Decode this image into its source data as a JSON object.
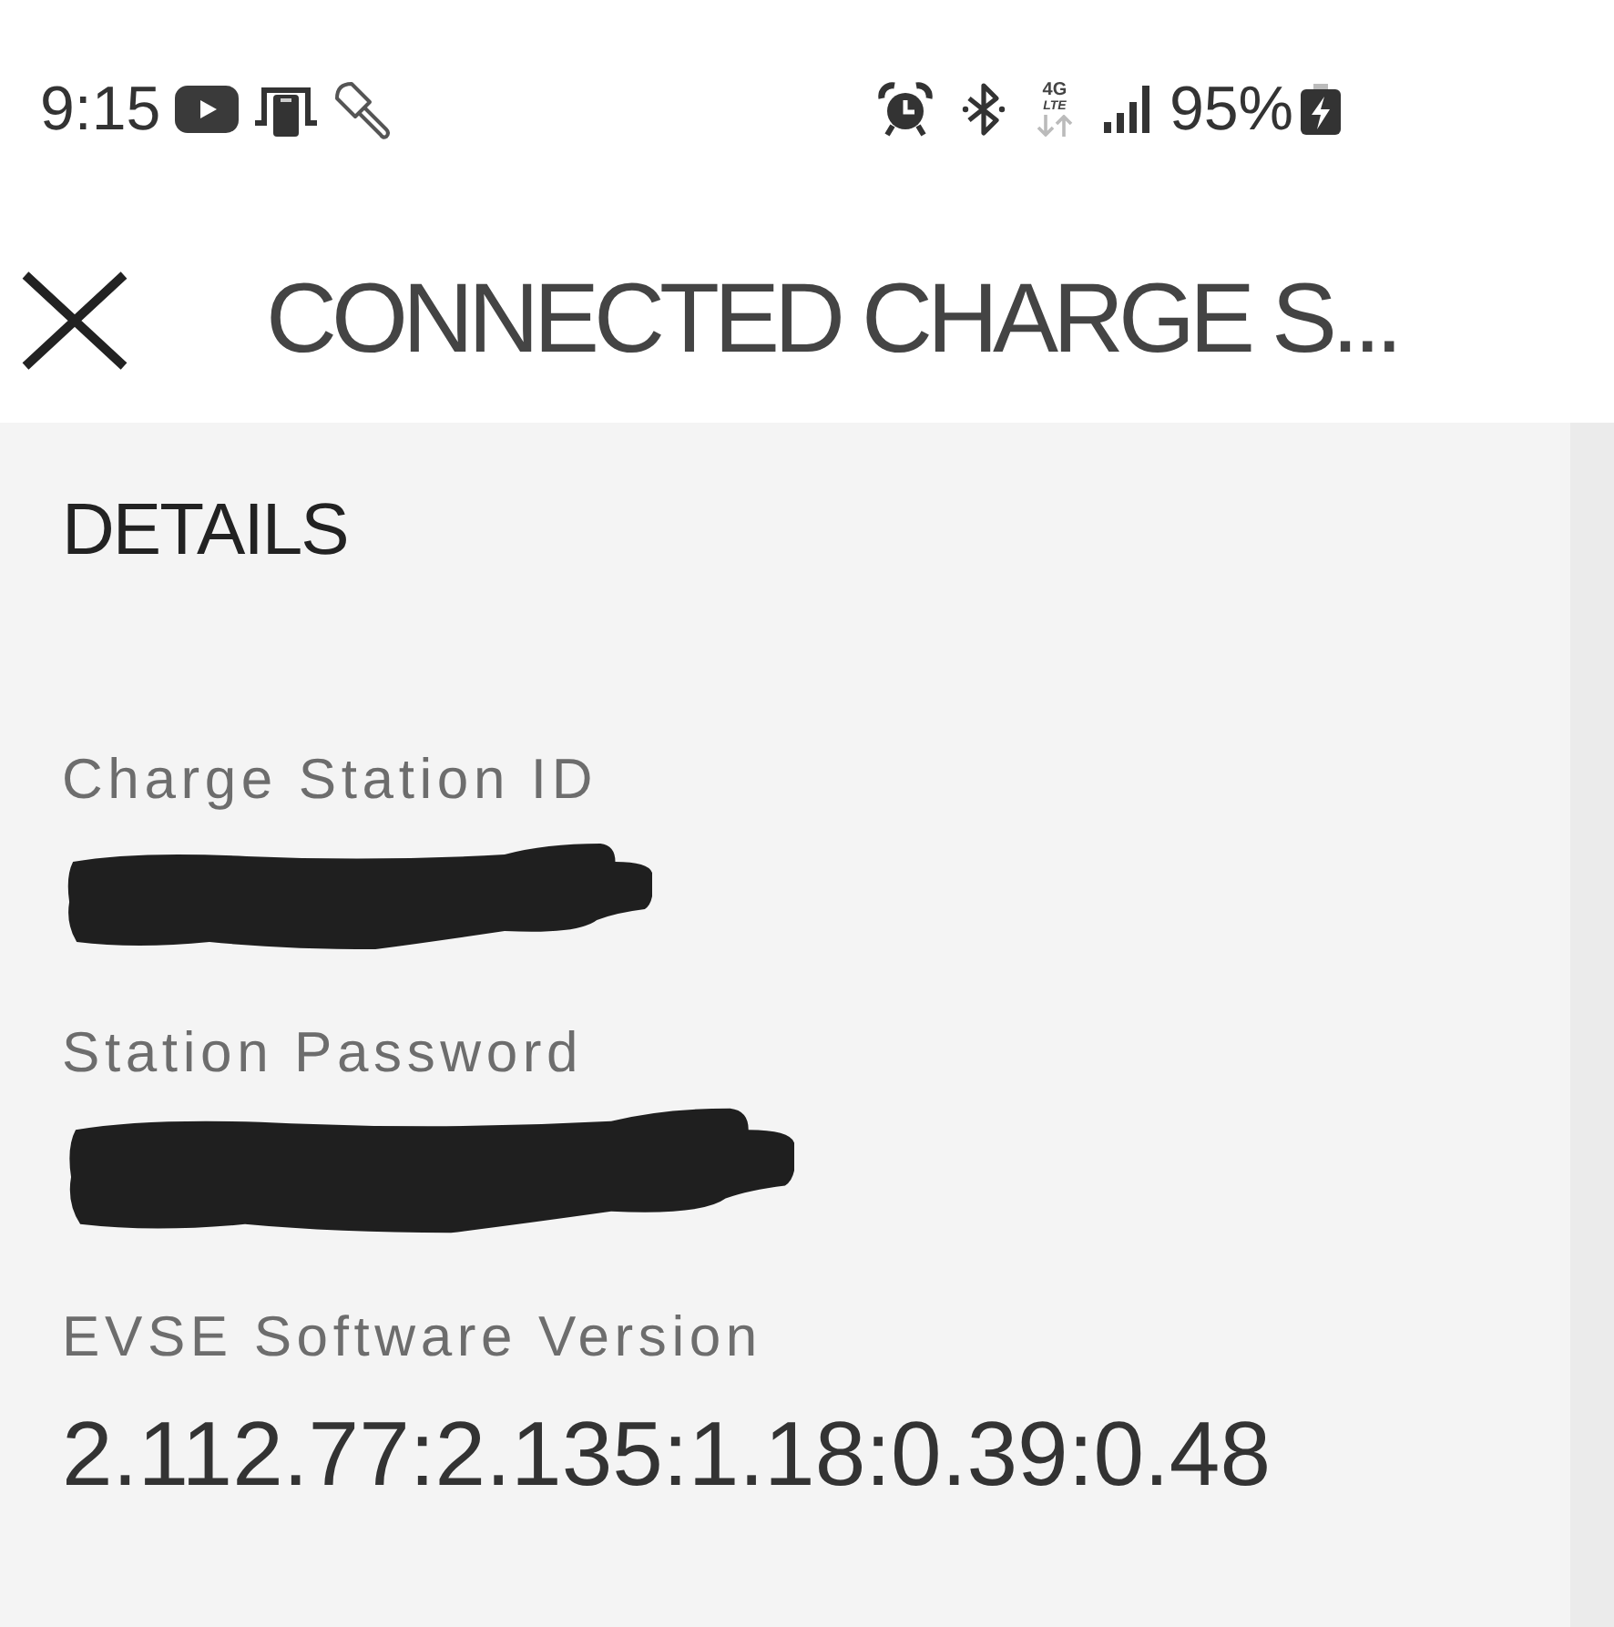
{
  "status_bar": {
    "time": "9:15",
    "network": {
      "generation": "4G",
      "technology": "LTE"
    },
    "battery": "95%"
  },
  "app_bar": {
    "title": "CONNECTED CHARGE S..."
  },
  "details": {
    "heading": "DETAILS",
    "fields": [
      {
        "label": "Charge Station ID",
        "redacted": true
      },
      {
        "label": "Station Password",
        "redacted": true
      },
      {
        "label": "EVSE Software Version",
        "value": "2.112.77:2.135:1.18:0.39:0.48",
        "redacted": false
      }
    ]
  }
}
